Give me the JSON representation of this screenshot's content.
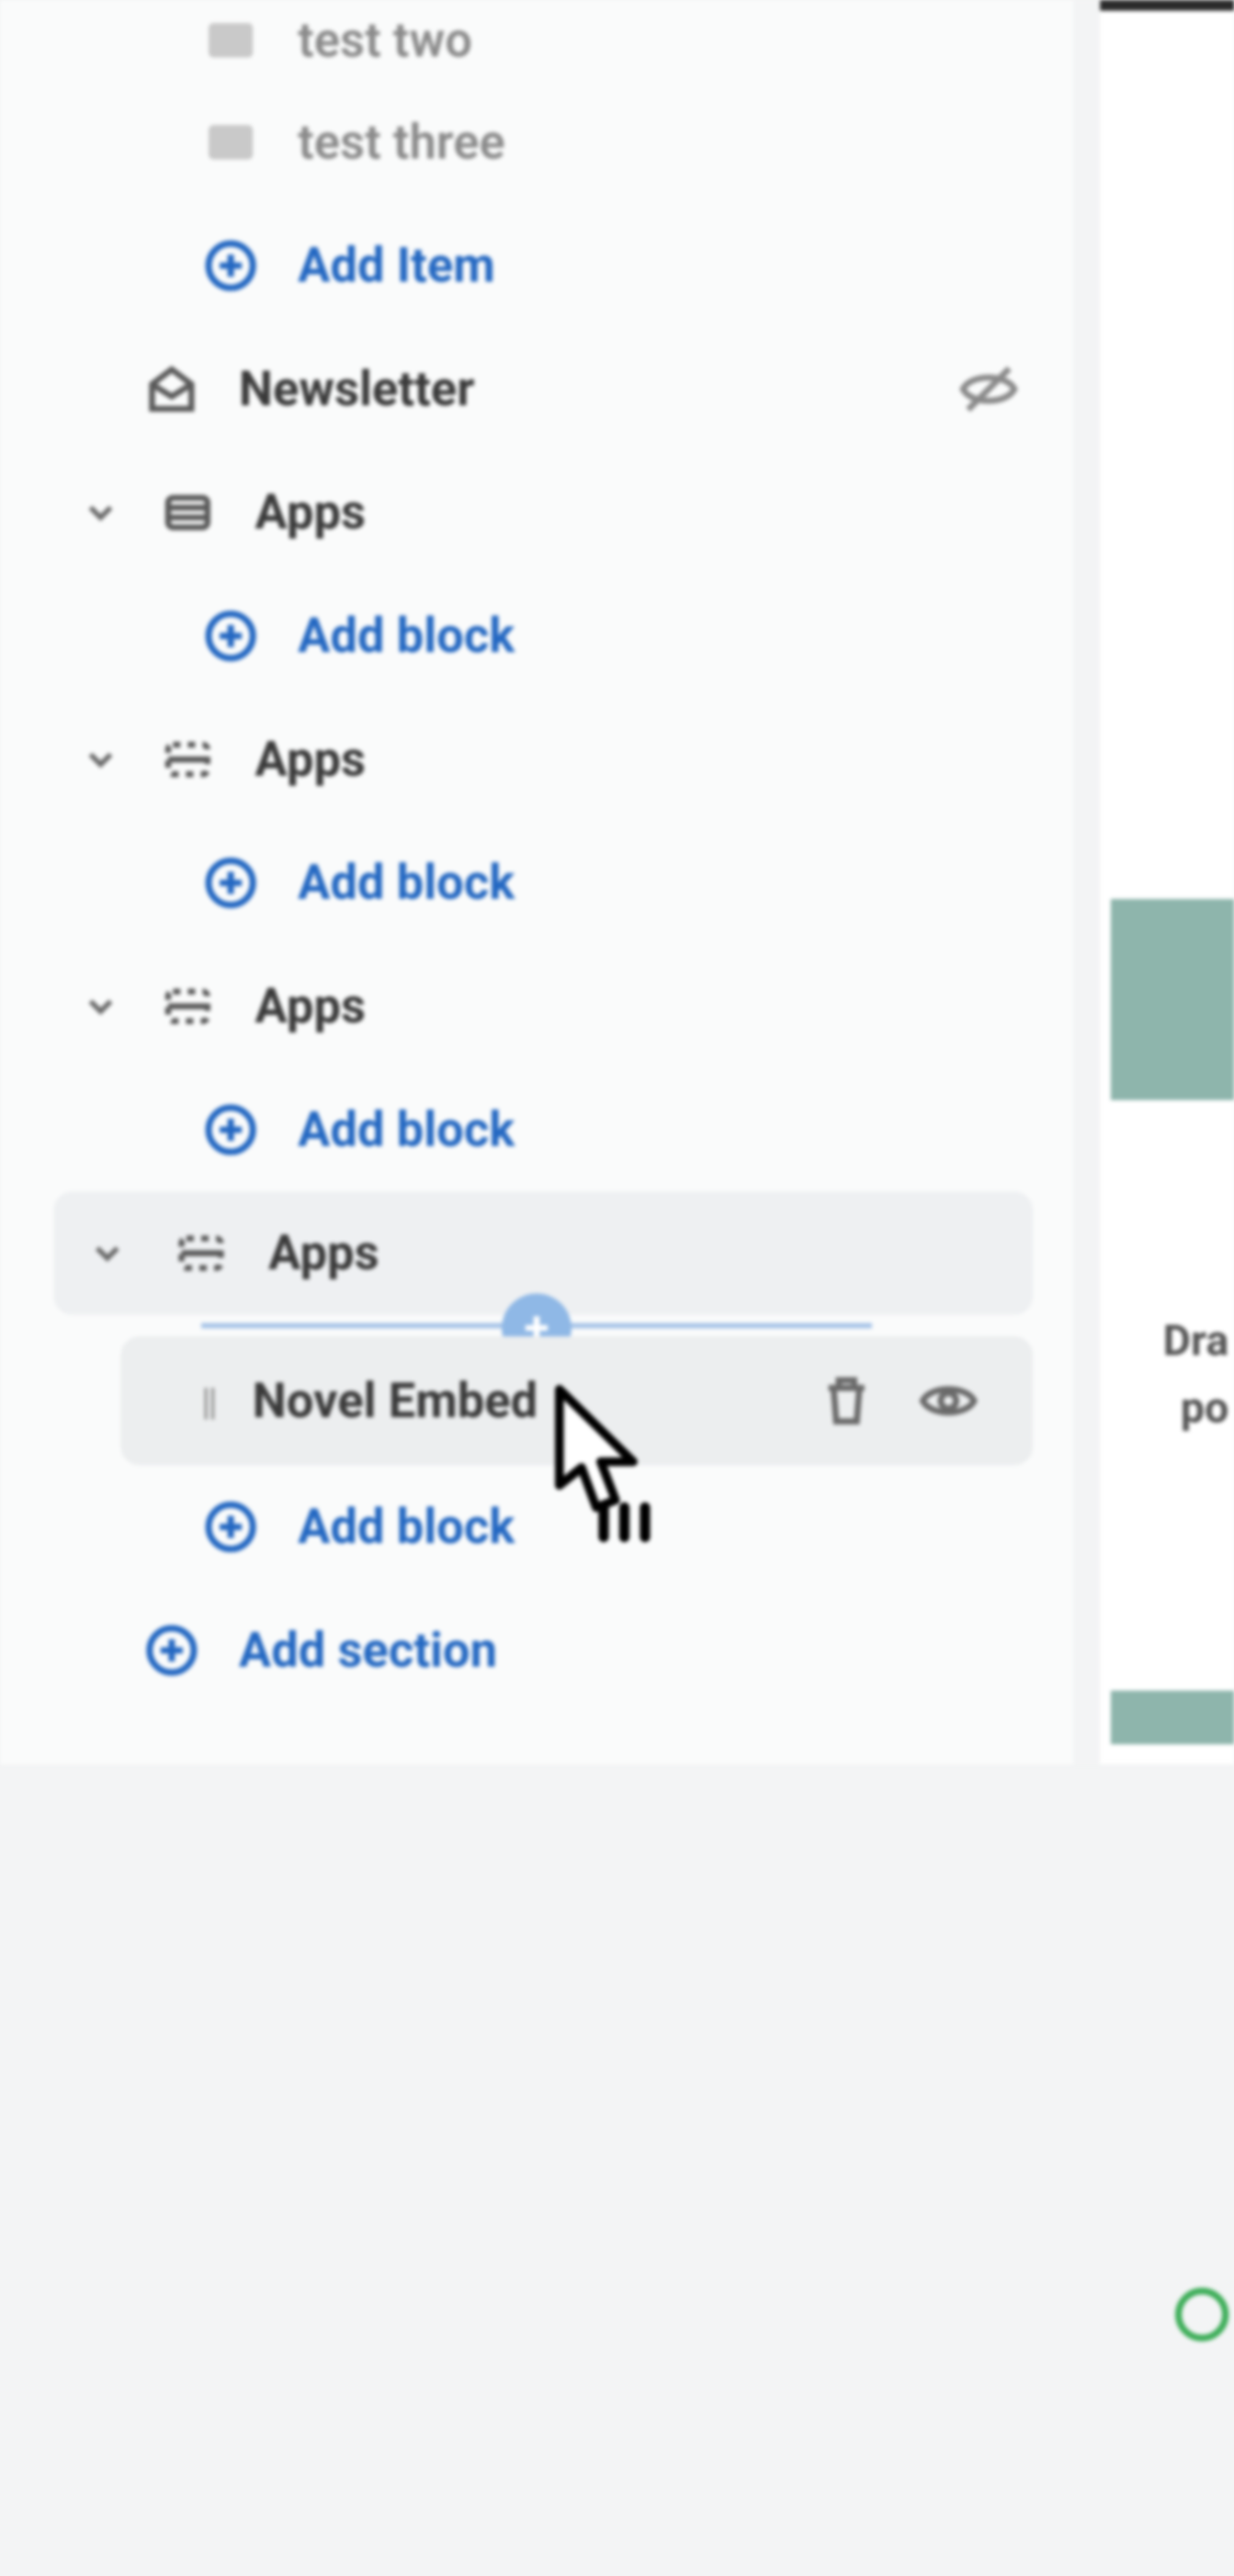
{
  "items": {
    "test_two": "test two",
    "test_three": "test three"
  },
  "actions": {
    "add_item": "Add Item",
    "add_block": "Add block",
    "add_section": "Add section"
  },
  "sections": {
    "newsletter": "Newsletter",
    "apps": "Apps"
  },
  "blocks": {
    "novel_embed": "Novel Embed"
  },
  "preview": {
    "dra": "Dra",
    "po": "po"
  },
  "glyphs": {
    "plus": "+",
    "drag": "||"
  }
}
